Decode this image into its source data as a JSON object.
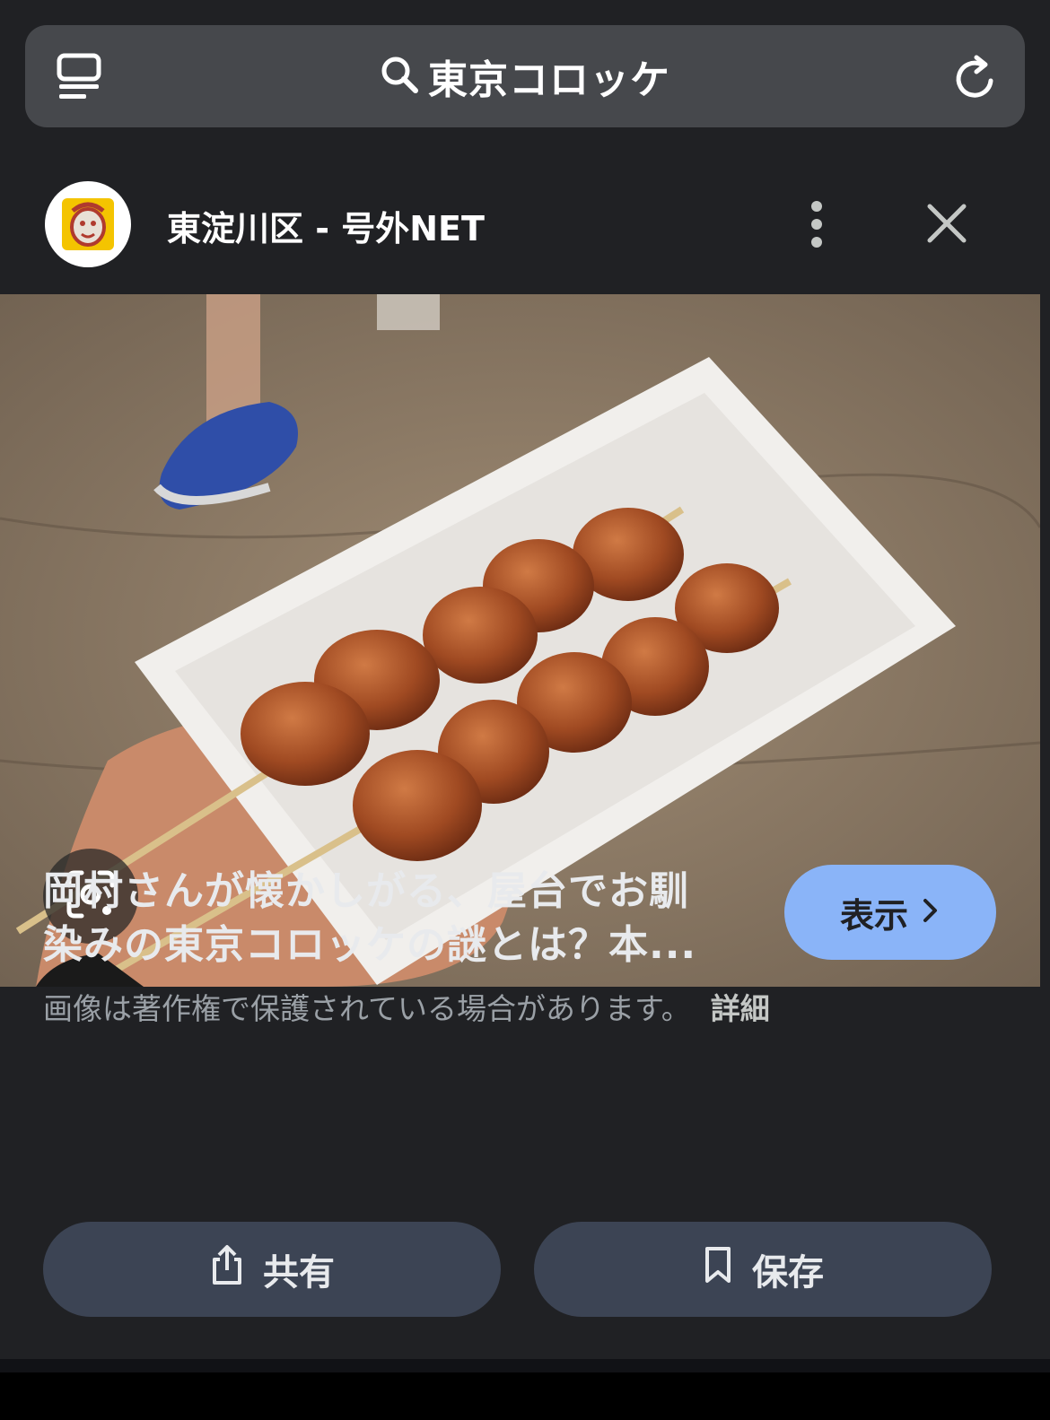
{
  "search": {
    "query": "東京コロッケ"
  },
  "source": {
    "title": "東淀川区 - 号外NET"
  },
  "result": {
    "caption_line1": "岡村さんが懐かしがる、屋台でお馴",
    "caption_line2": "染みの東京コロッケの謎とは？本...",
    "view_label": "表示",
    "copyright_notice": "画像は著作権で保護されている場合があります。",
    "details_label": "詳細"
  },
  "actions": {
    "share_label": "共有",
    "save_label": "保存"
  },
  "colors": {
    "background": "#202124",
    "searchbox": "#46484c",
    "view_button": "#8ab4f8",
    "action_button": "#3c4454",
    "favicon_bg": "#f4c400"
  },
  "icons": [
    "tabs-icon",
    "search-icon",
    "reload-icon",
    "more-vert-icon",
    "close-icon",
    "lens-icon",
    "share-icon",
    "bookmark-icon",
    "chevron-right-icon"
  ]
}
